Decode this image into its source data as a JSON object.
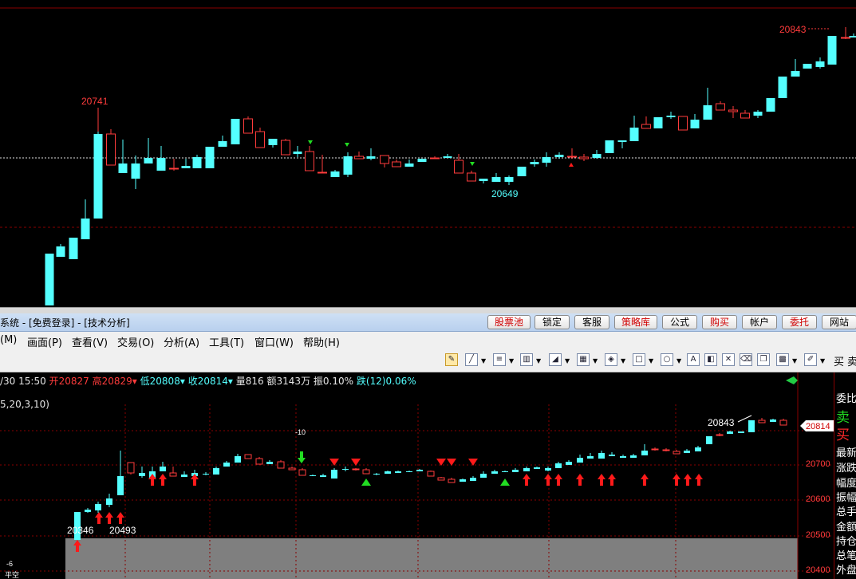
{
  "top_chart": {
    "marks": {
      "high": "20741",
      "low": "20649",
      "right_high": "20843"
    }
  },
  "window": {
    "title": "系统 - [免费登录] - [技术分析]",
    "buttons": [
      "股票池",
      "锁定",
      "客服",
      "策略库",
      "公式",
      "购买",
      "帐户",
      "委托",
      "网站"
    ],
    "red_buttons": [
      "股票池",
      "策略库",
      "购买",
      "委托"
    ]
  },
  "menu": [
    "(M)",
    "画面(P)",
    "查看(V)",
    "交易(O)",
    "分析(A)",
    "工具(T)",
    "窗口(W)",
    "帮助(H)"
  ],
  "toolbar": {
    "icons": [
      "draw-select-icon",
      "line-icon",
      "text-box-icon",
      "bar-chart-icon",
      "fan-icon",
      "grid-icon",
      "fib-icon",
      "rectangle-icon",
      "ellipse-icon",
      "text-icon",
      "shape-icon",
      "delete-icon",
      "eraser-icon",
      "copy-icon",
      "color-icon",
      "more-icon"
    ],
    "buy_label": "买",
    "sell_label": "卖"
  },
  "quote": {
    "time": "/30 15:50",
    "open_label": "开",
    "open": "20827",
    "high_label": "高",
    "high": "20829",
    "low_label": "低",
    "low": "20808",
    "close_label": "收",
    "close": "20814",
    "volume_label": "量",
    "volume": "816",
    "amount_label": "额",
    "amount": "3143万",
    "amplitude_label": "振",
    "amplitude": "0.10%",
    "change_label": "跌",
    "change": "(12)0.06%",
    "params": "5,20,3,10)"
  },
  "lower_chart": {
    "y_ticks": [
      "20814",
      "20700",
      "20600",
      "20500",
      "20400"
    ],
    "labels": {
      "left_low": "20346",
      "left_low2": "20493",
      "right_high": "20843",
      "left_minus": "-6",
      "left_minus_text": "平空",
      "minus10": "-10"
    }
  },
  "side_panel": {
    "items": [
      "委比",
      "卖",
      "买",
      "最新",
      "涨跌",
      "幅度",
      "振幅",
      "总手",
      "金额",
      "持仓",
      "总笔",
      "外盘"
    ]
  },
  "colors": {
    "up": "#ff3c3c",
    "down": "#54ffff",
    "bg": "#000000",
    "signal_green": "#22dd22",
    "signal_red": "#ff1a1a"
  }
}
